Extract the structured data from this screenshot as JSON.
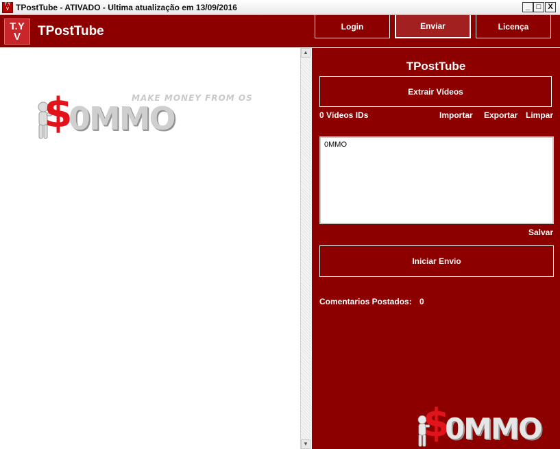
{
  "window": {
    "title": "TPostTube - ATIVADO - Ultima atualização em 13/09/2016",
    "icon_label": "T.Y V",
    "controls": [
      "_",
      "□",
      "X"
    ]
  },
  "header": {
    "logo_text_top": "T.Y",
    "logo_text_bottom": "V",
    "app_name": "TPostTube",
    "buttons": {
      "login": "Login",
      "enviar": "Enviar",
      "licenca": "Licença"
    }
  },
  "browser": {
    "logo": {
      "dollar": "$",
      "brand": "0MMO",
      "tagline": "MAKE MONEY FROM OS"
    },
    "scroll_up": "▲",
    "scroll_down": "▼"
  },
  "panel": {
    "title": "TPostTube",
    "extract_button": "Extrair Vídeos",
    "ids_count": "0 Vídeos IDs",
    "links": {
      "importar": "Importar",
      "exportar": "Exportar",
      "limpar": "Limpar"
    },
    "ids_text": "0MMO",
    "save_link": "Salvar",
    "start_button": "Iniciar Envio",
    "comments_label": "Comentarios Postados:",
    "comments_count": "0",
    "logo": {
      "dollar": "$",
      "brand": "0MMO"
    }
  },
  "colors": {
    "brand_dark_red": "#8c0000",
    "logo_red": "#e1141c"
  }
}
